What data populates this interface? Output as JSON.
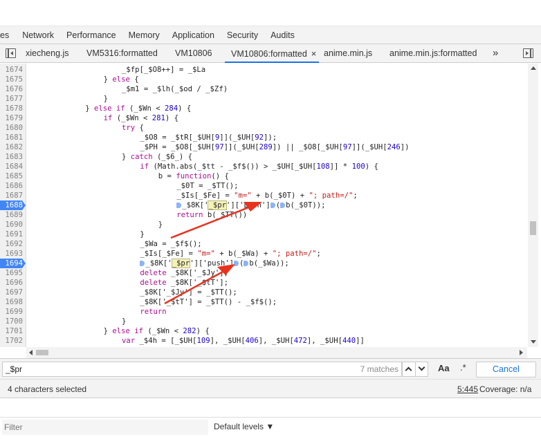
{
  "panel_tabs": [
    "es",
    "Network",
    "Performance",
    "Memory",
    "Application",
    "Security",
    "Audits"
  ],
  "file_tabs": [
    "xiecheng.js",
    "VM5316:formatted",
    "VM10806",
    "VM10806:formatted",
    "anime.min.js",
    "anime.min.js:formatted"
  ],
  "active_file_tab": "VM10806:formatted",
  "more_tabs_glyph": "»",
  "close_glyph": "×",
  "code_lines": [
    {
      "ln": "1674",
      "indent": 20,
      "segs": [
        [
          "_$fp[_$O8++] = _$La",
          ""
        ]
      ]
    },
    {
      "ln": "1675",
      "indent": 16,
      "segs": [
        [
          "} ",
          ""
        ],
        [
          "else",
          "kw"
        ],
        [
          " {",
          ""
        ]
      ]
    },
    {
      "ln": "1676",
      "indent": 20,
      "segs": [
        [
          "_$m1 = _$lh(_$od / _$Zf)",
          ""
        ]
      ]
    },
    {
      "ln": "1677",
      "indent": 16,
      "segs": [
        [
          "}",
          ""
        ]
      ]
    },
    {
      "ln": "1678",
      "indent": 12,
      "segs": [
        [
          "} ",
          ""
        ],
        [
          "else if",
          "kw"
        ],
        [
          " (_$Wn < ",
          ""
        ],
        [
          "284",
          "num"
        ],
        [
          ") {",
          ""
        ]
      ]
    },
    {
      "ln": "1679",
      "indent": 16,
      "segs": [
        [
          "if",
          "kw"
        ],
        [
          " (_$Wn < ",
          ""
        ],
        [
          "281",
          "num"
        ],
        [
          ") {",
          ""
        ]
      ]
    },
    {
      "ln": "1680",
      "indent": 20,
      "segs": [
        [
          "try",
          "kw"
        ],
        [
          " {",
          ""
        ]
      ]
    },
    {
      "ln": "1681",
      "indent": 24,
      "segs": [
        [
          "_$O8 = _$tR[_$UH[",
          ""
        ],
        [
          "9",
          "num"
        ],
        [
          "]](_$UH[",
          ""
        ],
        [
          "92",
          "num"
        ],
        [
          "]);",
          ""
        ]
      ]
    },
    {
      "ln": "1682",
      "indent": 24,
      "segs": [
        [
          "_$PH = _$O8[_$UH[",
          ""
        ],
        [
          "97",
          "num"
        ],
        [
          "]](_$UH[",
          ""
        ],
        [
          "289",
          "num"
        ],
        [
          "]) || _$O8[_$UH[",
          ""
        ],
        [
          "97",
          "num"
        ],
        [
          "]](_$UH[",
          ""
        ],
        [
          "246",
          "num"
        ],
        [
          "])",
          ""
        ]
      ]
    },
    {
      "ln": "1683",
      "indent": 20,
      "segs": [
        [
          "} ",
          ""
        ],
        [
          "catch",
          "kw"
        ],
        [
          " (_$6_) {",
          ""
        ]
      ]
    },
    {
      "ln": "1684",
      "indent": 24,
      "segs": [
        [
          "if",
          "kw"
        ],
        [
          " (Math.abs(_$tt - _$f$()) > _$UH[_$UH[",
          ""
        ],
        [
          "108",
          "num"
        ],
        [
          "]] * ",
          ""
        ],
        [
          "100",
          "num"
        ],
        [
          ") {",
          ""
        ]
      ]
    },
    {
      "ln": "1685",
      "indent": 28,
      "segs": [
        [
          "b = ",
          ""
        ],
        [
          "function",
          "kw"
        ],
        [
          "() {",
          ""
        ]
      ]
    },
    {
      "ln": "1686",
      "indent": 32,
      "segs": [
        [
          "_$0T = _$TT();",
          ""
        ]
      ]
    },
    {
      "ln": "1687",
      "indent": 32,
      "segs": [
        [
          "_$Is[_$Fe] = ",
          ""
        ],
        [
          "\"m=\"",
          "str"
        ],
        [
          " + b(_$0T) + ",
          ""
        ],
        [
          "\"; path=/\"",
          "str"
        ],
        [
          ";",
          ""
        ]
      ]
    },
    {
      "ln": "1688",
      "indent": 32,
      "bp": true,
      "segs": [
        [
          "@",
          "mk"
        ],
        [
          "_$8K['",
          ""
        ],
        [
          "_$pr",
          "hl"
        ],
        [
          "']['push']",
          ""
        ],
        [
          "@",
          "mk"
        ],
        [
          "(",
          ""
        ],
        [
          "@",
          "mk"
        ],
        [
          "b(_$0T));",
          ""
        ]
      ]
    },
    {
      "ln": "1689",
      "indent": 32,
      "segs": [
        [
          "return",
          "kw"
        ],
        [
          " b(_$TT())",
          ""
        ]
      ]
    },
    {
      "ln": "1690",
      "indent": 28,
      "segs": [
        [
          "}",
          ""
        ]
      ]
    },
    {
      "ln": "1691",
      "indent": 24,
      "segs": [
        [
          "}",
          ""
        ]
      ]
    },
    {
      "ln": "1692",
      "indent": 24,
      "segs": [
        [
          "_$Wa = _$f$();",
          ""
        ]
      ]
    },
    {
      "ln": "1693",
      "indent": 24,
      "segs": [
        [
          "_$Is[_$Fe] = ",
          ""
        ],
        [
          "\"m=\"",
          "str"
        ],
        [
          " + b(_$Wa) + ",
          ""
        ],
        [
          "\"; path=/\"",
          "str"
        ],
        [
          ";",
          ""
        ]
      ]
    },
    {
      "ln": "1694",
      "indent": 24,
      "bp": true,
      "segs": [
        [
          "@",
          "mk"
        ],
        [
          "_$8K['",
          ""
        ],
        [
          "_$pr",
          "hl"
        ],
        [
          "']['push']",
          ""
        ],
        [
          "@",
          "mk"
        ],
        [
          "(",
          ""
        ],
        [
          "@",
          "mk"
        ],
        [
          "b(_$Wa));",
          ""
        ]
      ]
    },
    {
      "ln": "1695",
      "indent": 24,
      "segs": [
        [
          "delete",
          "kw"
        ],
        [
          " _$8K['_$Jy'];",
          ""
        ]
      ]
    },
    {
      "ln": "1696",
      "indent": 24,
      "segs": [
        [
          "delete",
          "kw"
        ],
        [
          " _$8K['_$tT'];",
          ""
        ]
      ]
    },
    {
      "ln": "1697",
      "indent": 24,
      "segs": [
        [
          "_$8K['_$Jy'] = _$TT();",
          ""
        ]
      ]
    },
    {
      "ln": "1698",
      "indent": 24,
      "segs": [
        [
          "_$8K['_$tT'] = _$TT() - _$f$();",
          ""
        ]
      ]
    },
    {
      "ln": "1699",
      "indent": 24,
      "segs": [
        [
          "return",
          "kw"
        ]
      ]
    },
    {
      "ln": "1700",
      "indent": 20,
      "segs": [
        [
          "}",
          ""
        ]
      ]
    },
    {
      "ln": "1701",
      "indent": 16,
      "segs": [
        [
          "} ",
          ""
        ],
        [
          "else if",
          "kw"
        ],
        [
          " (_$Wn < ",
          ""
        ],
        [
          "282",
          "num"
        ],
        [
          ") {",
          ""
        ]
      ]
    },
    {
      "ln": "1702",
      "indent": 20,
      "segs": [
        [
          "var",
          "kw"
        ],
        [
          " _$4h = [_$UH[",
          ""
        ],
        [
          "109",
          "num"
        ],
        [
          "], _$UH[",
          ""
        ],
        [
          "406",
          "num"
        ],
        [
          "], _$UH[",
          ""
        ],
        [
          "472",
          "num"
        ],
        [
          "], _$UH[",
          ""
        ],
        [
          "440",
          "num"
        ],
        [
          "]]",
          ""
        ]
      ]
    },
    {
      "ln": "1703",
      "indent": 0,
      "segs": []
    }
  ],
  "search": {
    "value": "_$pr",
    "matches": "7 matches",
    "case_label": "Aa",
    "regex_label": ".*",
    "cancel_label": "Cancel"
  },
  "status": {
    "selection": "4 characters selected",
    "position": "5:445",
    "coverage": "Coverage: n/a"
  },
  "console": {
    "filter_placeholder": "Filter",
    "levels_label": "Default levels ▼"
  },
  "colors": {
    "annotation_arrow": "#e8321e",
    "breakpoint": "#4285f4",
    "active_tab_underline": "#1a73e8"
  }
}
